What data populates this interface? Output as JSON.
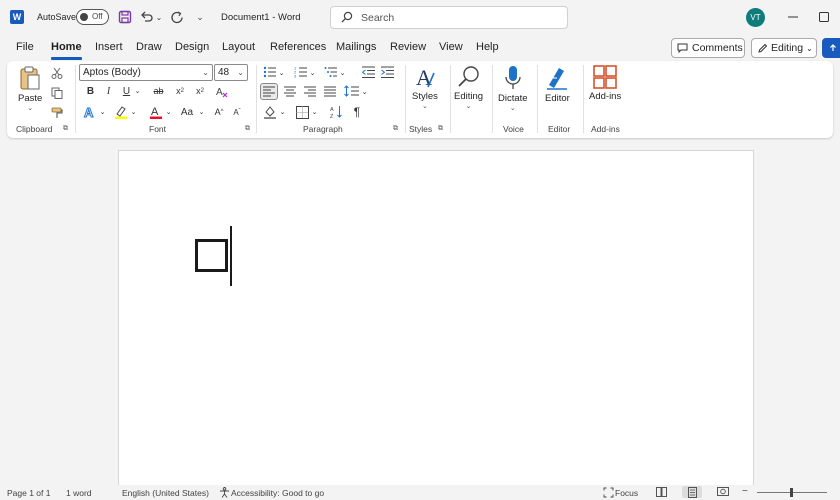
{
  "titlebar": {
    "autosave_label": "AutoSave",
    "autosave_state": "Off",
    "document_title": "Document1 - Word",
    "search_placeholder": "Search",
    "user_initials": "VT"
  },
  "tabs": [
    "File",
    "Home",
    "Insert",
    "Draw",
    "Design",
    "Layout",
    "References",
    "Mailings",
    "Review",
    "View",
    "Help"
  ],
  "active_tab": "Home",
  "header_buttons": {
    "comments_label": "Comments",
    "editing_label": "Editing"
  },
  "ribbon": {
    "clipboard": {
      "paste_label": "Paste",
      "group_label": "Clipboard"
    },
    "font": {
      "font_name": "Aptos (Body)",
      "font_size": "48",
      "group_label": "Font",
      "case_label": "Aa"
    },
    "paragraph": {
      "group_label": "Paragraph"
    },
    "styles": {
      "styles_label": "Styles",
      "group_label": "Styles"
    },
    "editing": {
      "label": "Editing"
    },
    "voice": {
      "dictate_label": "Dictate",
      "group_label": "Voice"
    },
    "editor": {
      "editor_label": "Editor",
      "group_label": "Editor"
    },
    "addins": {
      "addins_label": "Add-ins",
      "group_label": "Add-ins"
    }
  },
  "statusbar": {
    "page_info": "Page 1 of 1",
    "word_count": "1 word",
    "language": "English (United States)",
    "accessibility": "Accessibility: Good to go",
    "focus_label": "Focus"
  },
  "colors": {
    "accent": "#185abd",
    "avatar": "#0e7c7b",
    "highlight": "#ffff00",
    "font_color": "#e81123"
  }
}
